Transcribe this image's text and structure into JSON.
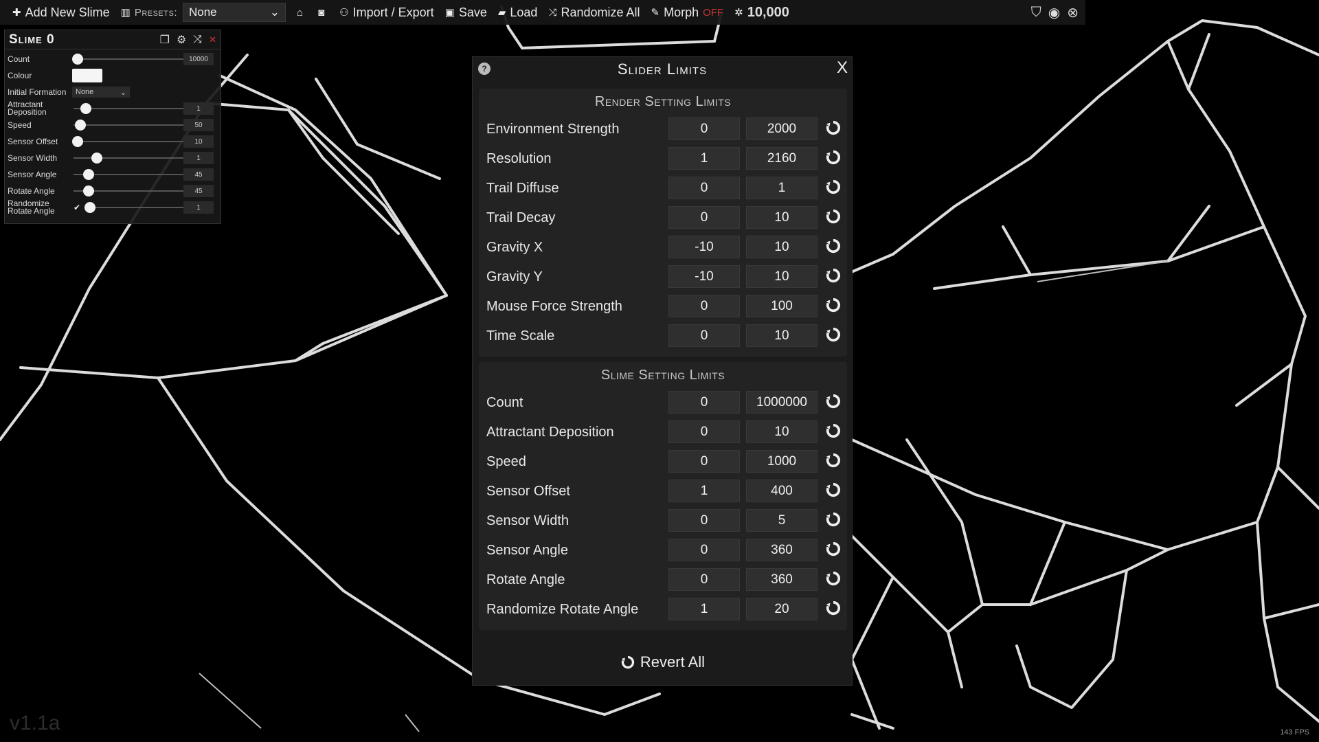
{
  "toolbar": {
    "add_slime": "Add New Slime",
    "presets_label": "Presets:",
    "preset_value": "None",
    "import_export": "Import / Export",
    "save": "Save",
    "load": "Load",
    "randomize_all": "Randomize All",
    "morph": "Morph",
    "morph_state": "OFF",
    "agent_count": "10,000"
  },
  "slime_panel": {
    "title": "Slime 0",
    "rows": {
      "count": {
        "label": "Count",
        "value": "10000"
      },
      "colour": {
        "label": "Colour"
      },
      "initial_formation": {
        "label": "Initial Formation",
        "value": "None"
      },
      "attractant_deposition": {
        "label": "Attractant Deposition",
        "value": "1"
      },
      "speed": {
        "label": "Speed",
        "value": "50"
      },
      "sensor_offset": {
        "label": "Sensor Offset",
        "value": "10"
      },
      "sensor_width": {
        "label": "Sensor Width",
        "value": "1"
      },
      "sensor_angle": {
        "label": "Sensor Angle",
        "value": "45"
      },
      "rotate_angle": {
        "label": "Rotate Angle",
        "value": "45"
      },
      "randomize_rotate_angle": {
        "label": "Randomize Rotate Angle",
        "value": "1",
        "checked": true
      }
    }
  },
  "modal": {
    "title": "Slider Limits",
    "help": "?",
    "close": "X",
    "render_section_title": "Render Setting Limits",
    "render_rows": [
      {
        "name": "Environment Strength",
        "min": "0",
        "max": "2000"
      },
      {
        "name": "Resolution",
        "min": "1",
        "max": "2160"
      },
      {
        "name": "Trail Diffuse",
        "min": "0",
        "max": "1"
      },
      {
        "name": "Trail Decay",
        "min": "0",
        "max": "10"
      },
      {
        "name": "Gravity X",
        "min": "-10",
        "max": "10"
      },
      {
        "name": "Gravity Y",
        "min": "-10",
        "max": "10"
      },
      {
        "name": "Mouse Force Strength",
        "min": "0",
        "max": "100"
      },
      {
        "name": "Time Scale",
        "min": "0",
        "max": "10"
      }
    ],
    "slime_section_title": "Slime Setting Limits",
    "slime_rows": [
      {
        "name": "Count",
        "min": "0",
        "max": "1000000"
      },
      {
        "name": "Attractant Deposition",
        "min": "0",
        "max": "10"
      },
      {
        "name": "Speed",
        "min": "0",
        "max": "1000"
      },
      {
        "name": "Sensor Offset",
        "min": "1",
        "max": "400"
      },
      {
        "name": "Sensor Width",
        "min": "0",
        "max": "5"
      },
      {
        "name": "Sensor Angle",
        "min": "0",
        "max": "360"
      },
      {
        "name": "Rotate Angle",
        "min": "0",
        "max": "360"
      },
      {
        "name": "Randomize Rotate Angle",
        "min": "1",
        "max": "20"
      }
    ],
    "revert_all": "Revert All"
  },
  "footer": {
    "version": "v1.1a",
    "fps": "143 FPS"
  },
  "colors": {
    "background": "#000000",
    "panel": "#1b1b1b",
    "morph_off": "#e53b3b",
    "vein": "#e6e6e6"
  }
}
